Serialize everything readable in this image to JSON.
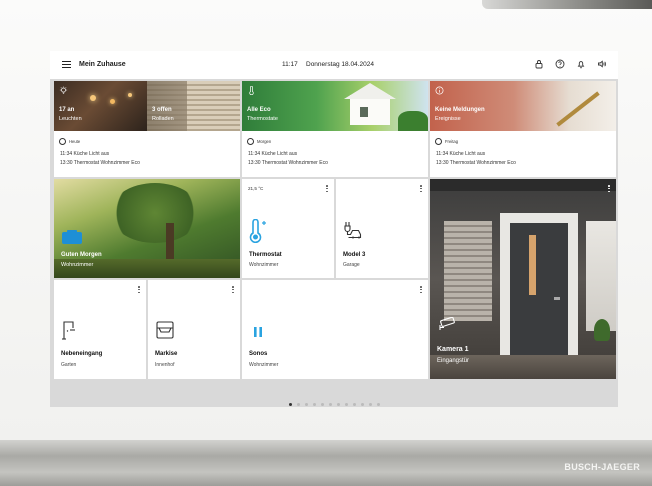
{
  "header": {
    "title": "Mein Zuhause",
    "time": "11:17",
    "date": "Donnerstag 18.04.2024",
    "icons": [
      "lock-icon",
      "help-icon",
      "bell-icon",
      "speaker-icon"
    ]
  },
  "summary": [
    {
      "count": "17 an",
      "label": "Leuchten",
      "day": "Heute",
      "events": [
        "11:34 Küche Licht aus",
        "13:30 Thermostat Wohnzimmer Eco"
      ]
    },
    {
      "count": "3 offen",
      "label": "Rolladen"
    },
    {
      "count": "Alle Eco",
      "label": "Thermostate",
      "day": "Morgen",
      "events": [
        "11:34 Küche Licht aus",
        "13:30 Thermostat Wohnzimmer Eco"
      ]
    },
    {
      "count": "Keine Meldungen",
      "label": "Ereignisse",
      "day": "Freitag",
      "events": [
        "11:34 Küche Licht aus",
        "13:30 Thermostat Wohnzimmer Eco"
      ]
    }
  ],
  "devices": {
    "scene": {
      "name": "Guten Morgen",
      "room": "Wohnzimmer"
    },
    "thermostat": {
      "temp": "21,5 °C",
      "name": "Thermostat",
      "room": "Wohnzimmer"
    },
    "car": {
      "name": "Model 3",
      "room": "Garage"
    },
    "camera": {
      "name": "Kamera 1",
      "room": "Eingangstür"
    },
    "door": {
      "name": "Nebeneingang",
      "room": "Garten"
    },
    "awning": {
      "name": "Markise",
      "room": "Innenhof"
    },
    "sonos": {
      "name": "Sonos",
      "room": "Wohnzimmer"
    }
  },
  "pager": {
    "pages": 12,
    "active": 0
  },
  "brand": "BUSCH-JAEGER",
  "colors": {
    "accent": "#2aa3e0",
    "screen_bg": "#d9d9d9"
  }
}
